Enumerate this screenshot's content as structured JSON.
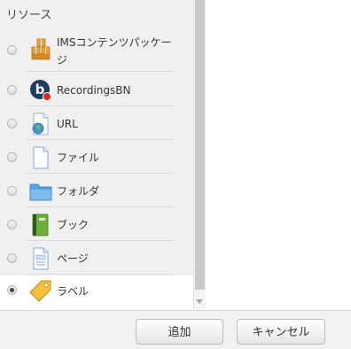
{
  "section": {
    "title": "リソース"
  },
  "items": [
    {
      "label_line1": "IMSコンテンツパッケー",
      "label_line2": "ジ",
      "icon": "ims-package-icon",
      "selected": false
    },
    {
      "label": "RecordingsBN",
      "icon": "recordingsbn-icon",
      "selected": false
    },
    {
      "label": "URL",
      "icon": "url-globe-icon",
      "selected": false
    },
    {
      "label": "ファイル",
      "icon": "file-icon",
      "selected": false
    },
    {
      "label": "フォルダ",
      "icon": "folder-icon",
      "selected": false
    },
    {
      "label": "ブック",
      "icon": "book-icon",
      "selected": false
    },
    {
      "label": "ページ",
      "icon": "page-icon",
      "selected": false
    },
    {
      "label": "ラベル",
      "icon": "label-tag-icon",
      "selected": true
    }
  ],
  "footer": {
    "add_label": "追加",
    "cancel_label": "キャンセル"
  },
  "colors": {
    "panel_bg": "#f0f0f0",
    "selected_bg": "#ffffff",
    "footer_bg": "#f2f2f2"
  }
}
